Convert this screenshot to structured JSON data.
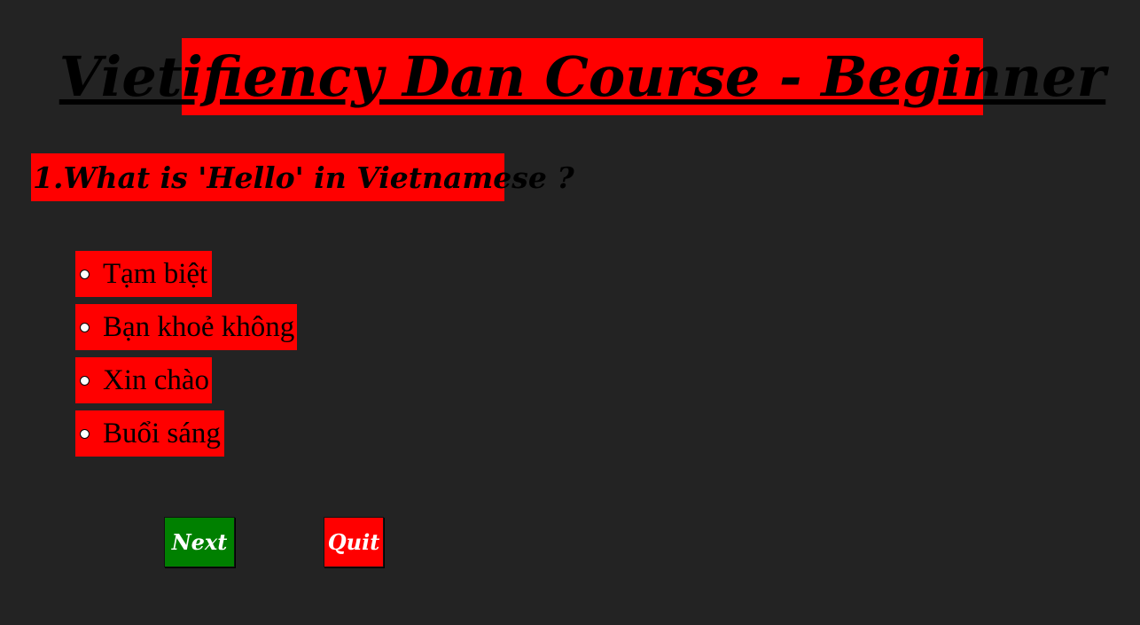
{
  "page": {
    "title": "Vietifiency Dan Course - Beginner"
  },
  "quiz": {
    "question": "1.What is 'Hello' in Vietnamese ?",
    "options": [
      {
        "label": "Tạm biệt"
      },
      {
        "label": "Bạn khoẻ không"
      },
      {
        "label": "Xin chào"
      },
      {
        "label": "Buổi sáng"
      }
    ]
  },
  "buttons": {
    "next_label": "Next",
    "quit_label": "Quit"
  },
  "colors": {
    "background": "#232323",
    "accent_red": "#ff0000",
    "next_green": "#008000"
  }
}
